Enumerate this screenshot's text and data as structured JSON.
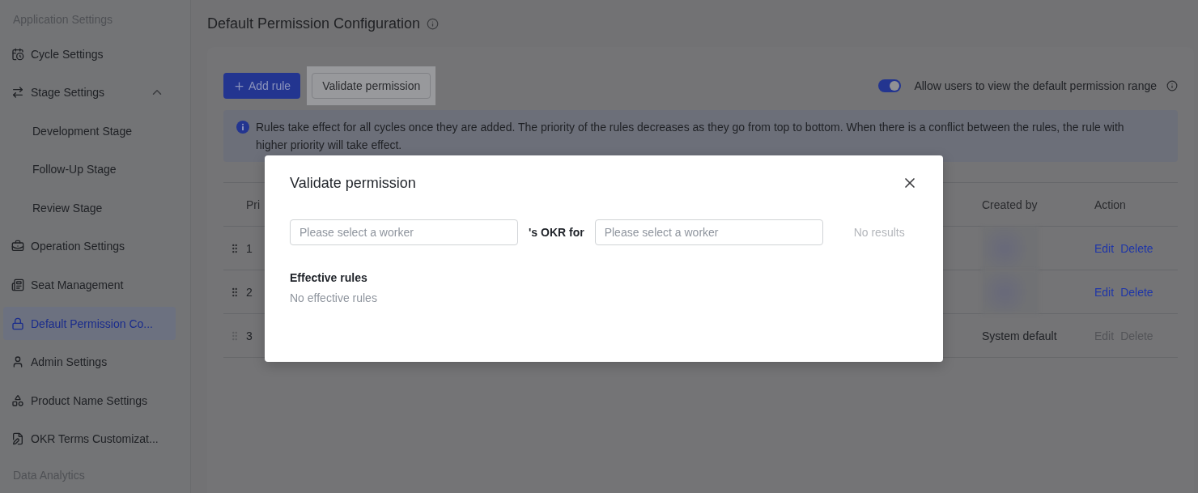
{
  "sidebar": {
    "sections": [
      {
        "heading": "Application Settings",
        "items": [
          {
            "label": "Cycle Settings",
            "selected": false
          },
          {
            "label": "Stage Settings",
            "selected": false,
            "expanded": true,
            "children": [
              {
                "label": "Development Stage",
                "selected": false
              },
              {
                "label": "Follow-Up Stage",
                "selected": false
              },
              {
                "label": "Review Stage",
                "selected": false
              }
            ]
          },
          {
            "label": "Operation Settings",
            "selected": false
          },
          {
            "label": "Seat Management",
            "selected": false
          },
          {
            "label": "Default Permission Co...",
            "selected": true
          },
          {
            "label": "Admin Settings",
            "selected": false
          },
          {
            "label": "Product Name Settings",
            "selected": false
          },
          {
            "label": "OKR Terms Customizat...",
            "selected": false
          }
        ]
      },
      {
        "heading": "Data Analytics"
      }
    ]
  },
  "page": {
    "title": "Default Permission Configuration",
    "add_button": "Add rule",
    "validate_button": "Validate permission",
    "toggle": {
      "label": "Allow users to view the default permission range",
      "on": true
    },
    "notice": "Rules take effect for all cycles once they are added. The priority of the rules decreases as they go from top to bottom. When there is a conflict between the rules, the rule with higher priority will take effect.",
    "table": {
      "columns": [
        "Pri",
        "Created by",
        "Action"
      ],
      "rows": [
        {
          "priority": "1",
          "creator": {
            "kind": "avatar"
          },
          "actions": [
            "Edit",
            "Delete"
          ],
          "disabled": false
        },
        {
          "priority": "2",
          "creator": {
            "kind": "avatar"
          },
          "actions": [
            "Edit",
            "Delete"
          ],
          "disabled": false
        },
        {
          "priority": "3",
          "creator": {
            "kind": "text",
            "text": "System default"
          },
          "actions": [
            "Edit",
            "Delete"
          ],
          "disabled": true
        }
      ]
    }
  },
  "dialog": {
    "title": "Validate permission",
    "first_field": {
      "placeholder": "Please select a worker"
    },
    "connector": "'s OKR for",
    "second_field": {
      "placeholder": "Please select a worker"
    },
    "result": "No results",
    "section_title": "Effective rules",
    "empty_text": "No effective rules"
  }
}
